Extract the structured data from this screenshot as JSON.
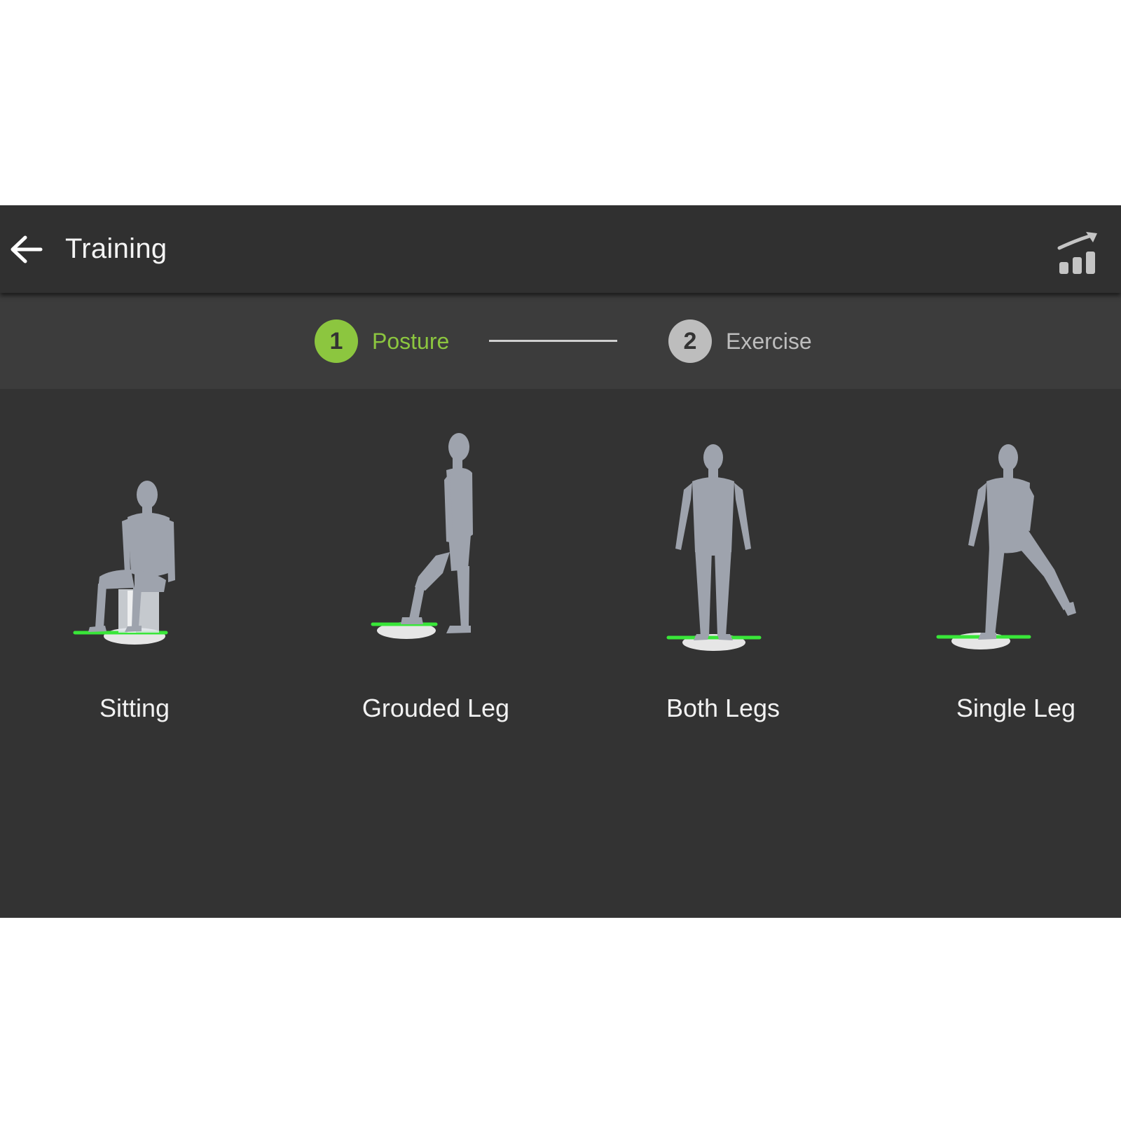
{
  "header": {
    "title": "Training",
    "back_icon": "arrow-left-icon",
    "stats_icon": "chart-trend-icon"
  },
  "stepper": {
    "steps": [
      {
        "number": "1",
        "label": "Posture",
        "state": "active"
      },
      {
        "number": "2",
        "label": "Exercise",
        "state": "inactive"
      }
    ]
  },
  "postures": [
    {
      "label": "Sitting"
    },
    {
      "label": "Grouded Leg"
    },
    {
      "label": "Both Legs"
    },
    {
      "label": "Single Leg"
    }
  ],
  "colors": {
    "accent": "#8cc63f",
    "appbar": "#303030",
    "stepper_bg": "#3c3c3c",
    "content_bg": "#333333",
    "figure": "#9ea3ad",
    "board_line": "#39e639"
  }
}
